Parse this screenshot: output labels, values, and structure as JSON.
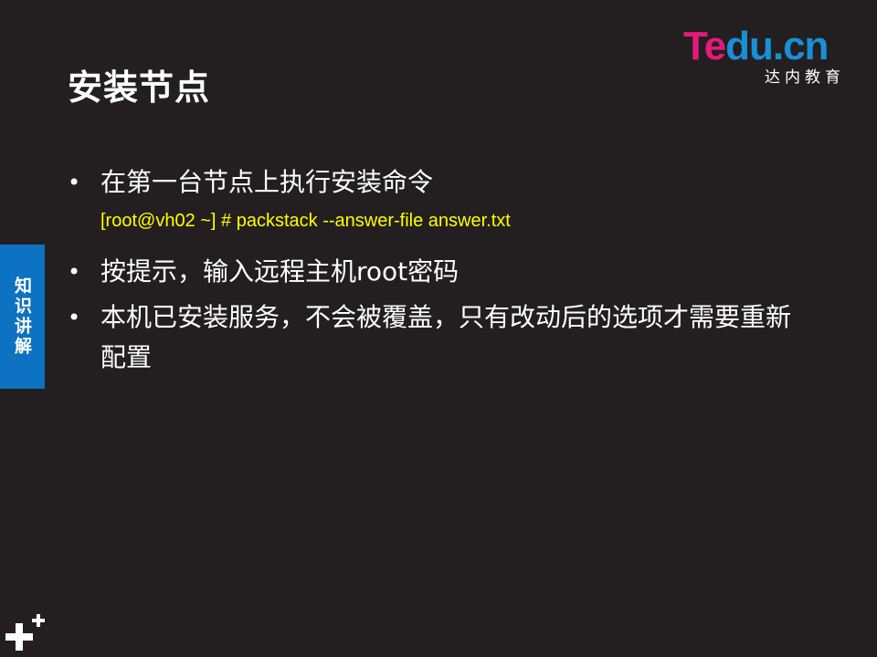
{
  "slide": {
    "title": "安装节点",
    "logo": {
      "word_part1": "Te",
      "word_part2": "du.cn",
      "subtitle": "达内教育",
      "colors": {
        "pink": "#e5197d",
        "blue": "#1a8fd6"
      }
    },
    "side_tab": {
      "label": "知识讲解",
      "color": "#0d72c1"
    },
    "bullets": [
      {
        "text": "在第一台节点上执行安装命令"
      },
      {
        "text": "按提示，输入远程主机root密码"
      },
      {
        "text": "本机已安装服务，不会被覆盖，只有改动后的选项才需要重新配置"
      }
    ],
    "command": "[root@vh02 ~] # packstack --answer-file answer.txt",
    "command_color": "#ffff00",
    "bullet_glyph": "•",
    "corner_icon": "plus-icon"
  }
}
